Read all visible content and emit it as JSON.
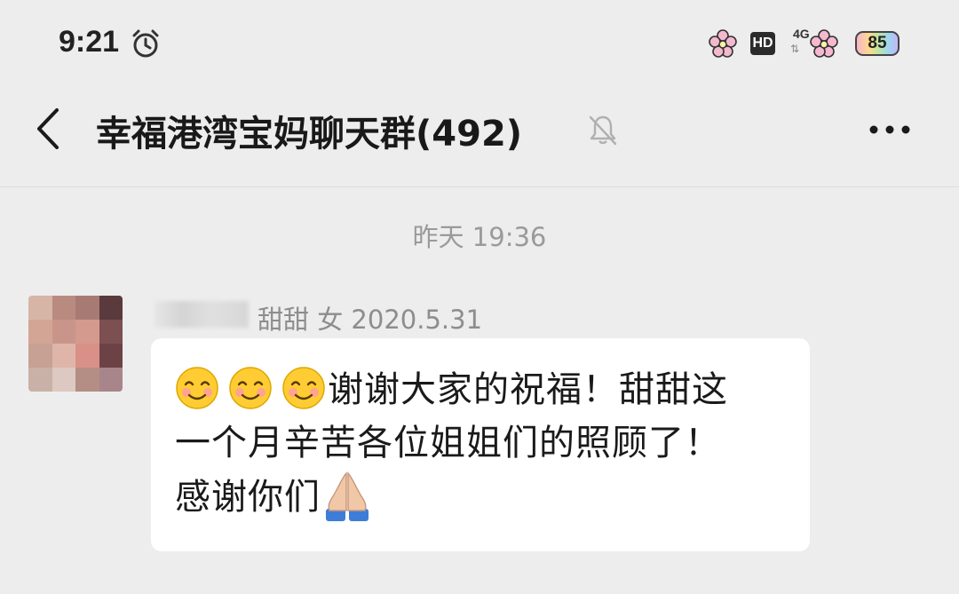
{
  "status_bar": {
    "time": "9:21",
    "hd_label": "HD",
    "network_label": "4G",
    "battery_level": "85",
    "icons": [
      "alarm-icon",
      "flower-icon",
      "hd-icon",
      "flower-icon",
      "battery-icon"
    ]
  },
  "header": {
    "title": "幸福港湾宝妈聊天群(492)",
    "back_icon": "chevron-left-icon",
    "mute_icon": "bell-off-icon",
    "more_icon": "more-dots-icon"
  },
  "chat": {
    "timestamp": "昨天 19:36",
    "messages": [
      {
        "sender_line": "甜甜 女 2020.5.31",
        "text_line1": "谢谢大家的祝福！甜甜这",
        "text_line2": "一个月辛苦各位姐姐们的照顾了！",
        "text_line3": "感谢你们",
        "emojis": [
          "smiling-face-icon",
          "smiling-face-icon",
          "smiling-face-icon",
          "folded-hands-icon"
        ]
      }
    ]
  },
  "colors": {
    "background": "#ededed",
    "bubble": "#ffffff",
    "timestamp": "#9a9a9a",
    "sender": "#8d8d8d"
  }
}
